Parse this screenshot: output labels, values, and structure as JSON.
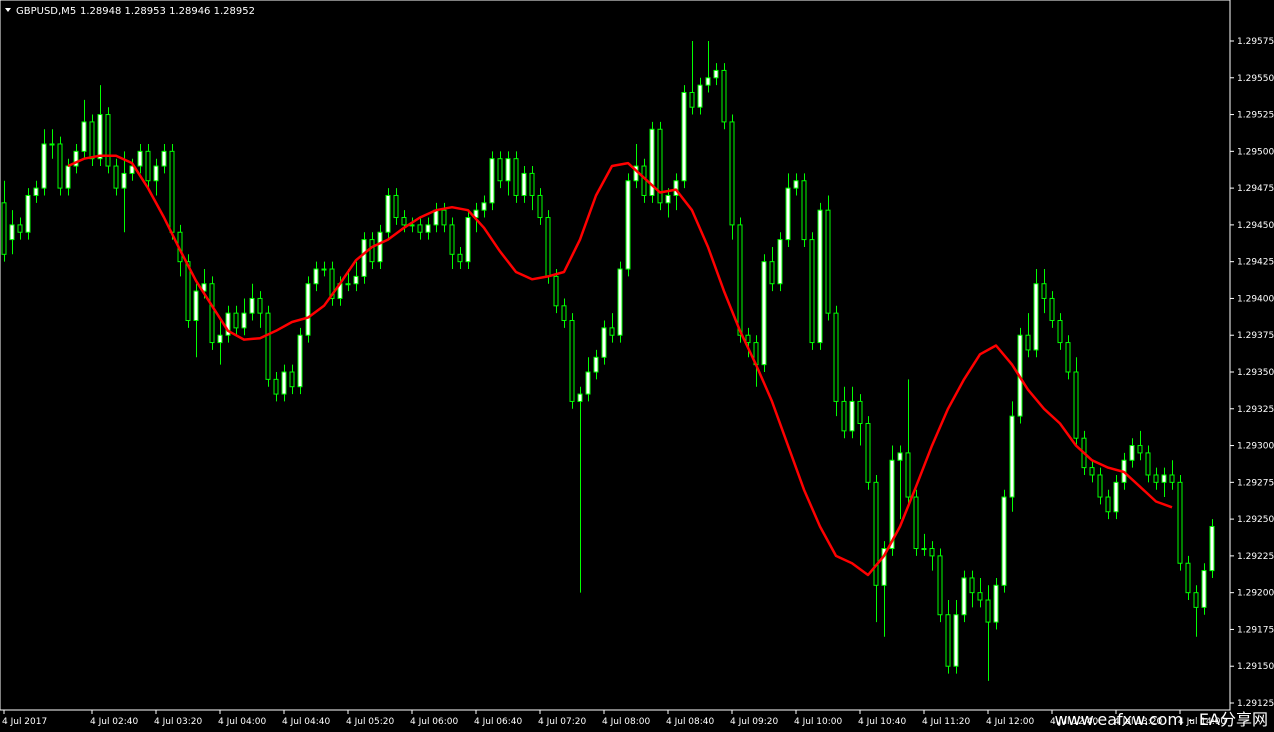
{
  "header": {
    "symbol": "GBPUSD,M5",
    "ohlc": "1.28948 1.28953 1.28946 1.28952",
    "menu_icon": "triangle-down-icon"
  },
  "watermark": "www.eafxw.com - EA分享网",
  "colors": {
    "background": "#000000",
    "frame": "#ffffff",
    "bull_fill": "#ffffff",
    "bear_fill": "#000000",
    "wick": "#00ff00",
    "ma_line": "#ff0000",
    "text": "#ffffff"
  },
  "chart_data": {
    "type": "candlestick",
    "title": "",
    "xlabel": "",
    "ylabel": "",
    "ylim": [
      1.29125,
      1.29585
    ],
    "y_ticks": [
      1.29575,
      1.2955,
      1.29525,
      1.295,
      1.29475,
      1.2945,
      1.29425,
      1.294,
      1.29375,
      1.2935,
      1.29325,
      1.293,
      1.29275,
      1.2925,
      1.29225,
      1.292,
      1.29175,
      1.2915,
      1.29125
    ],
    "y_tick_labels": [
      "1.29575",
      "1.29550",
      "1.29525",
      "1.29500",
      "1.29475",
      "1.29450",
      "1.29425",
      "1.29400",
      "1.29375",
      "1.29350",
      "1.29325",
      "1.29300",
      "1.29275",
      "1.29250",
      "1.29225",
      "1.29200",
      "1.29175",
      "1.29150",
      "1.29125"
    ],
    "x_ticks": [
      {
        "label": "4 Jul 2017",
        "bar": 0
      },
      {
        "label": "4 Jul 02:40",
        "bar": 11
      },
      {
        "label": "4 Jul 03:20",
        "bar": 19
      },
      {
        "label": "4 Jul 04:00",
        "bar": 27
      },
      {
        "label": "4 Jul 04:40",
        "bar": 35
      },
      {
        "label": "4 Jul 05:20",
        "bar": 43
      },
      {
        "label": "4 Jul 06:00",
        "bar": 51
      },
      {
        "label": "4 Jul 06:40",
        "bar": 59
      },
      {
        "label": "4 Jul 07:20",
        "bar": 67
      },
      {
        "label": "4 Jul 08:00",
        "bar": 75
      },
      {
        "label": "4 Jul 08:40",
        "bar": 83
      },
      {
        "label": "4 Jul 09:20",
        "bar": 91
      },
      {
        "label": "4 Jul 10:00",
        "bar": 99
      },
      {
        "label": "4 Jul 10:40",
        "bar": 107
      },
      {
        "label": "4 Jul 11:20",
        "bar": 115
      },
      {
        "label": "4 Jul 12:00",
        "bar": 123
      },
      {
        "label": "4 Jul 12:40",
        "bar": 131
      },
      {
        "label": "4 Jul 13:20",
        "bar": 139
      },
      {
        "label": "4 Jul 14:00",
        "bar": 147
      }
    ],
    "bar_count": 154,
    "candles": [
      [
        1.29465,
        1.2943,
        1.2948,
        1.29425
      ],
      [
        1.2944,
        1.2945,
        1.2946,
        1.2943
      ],
      [
        1.2945,
        1.29445,
        1.29455,
        1.2944
      ],
      [
        1.29445,
        1.2947,
        1.29475,
        1.2944
      ],
      [
        1.2947,
        1.29475,
        1.2948,
        1.29465
      ],
      [
        1.29475,
        1.29505,
        1.29515,
        1.2947
      ],
      [
        1.29505,
        1.29505,
        1.29515,
        1.29495
      ],
      [
        1.29505,
        1.29475,
        1.2951,
        1.2947
      ],
      [
        1.29475,
        1.2949,
        1.29495,
        1.2947
      ],
      [
        1.2949,
        1.295,
        1.29505,
        1.29485
      ],
      [
        1.295,
        1.2952,
        1.29535,
        1.29495
      ],
      [
        1.2952,
        1.29495,
        1.29525,
        1.2949
      ],
      [
        1.29495,
        1.29525,
        1.29545,
        1.2949
      ],
      [
        1.29525,
        1.2949,
        1.2953,
        1.29485
      ],
      [
        1.2949,
        1.29475,
        1.29495,
        1.2947
      ],
      [
        1.29475,
        1.29485,
        1.295,
        1.29445
      ],
      [
        1.29485,
        1.2949,
        1.29495,
        1.2948
      ],
      [
        1.2949,
        1.295,
        1.29505,
        1.29485
      ],
      [
        1.295,
        1.2948,
        1.29505,
        1.29475
      ],
      [
        1.2948,
        1.2949,
        1.29495,
        1.2947
      ],
      [
        1.2949,
        1.295,
        1.29505,
        1.29485
      ],
      [
        1.295,
        1.29445,
        1.29505,
        1.2944
      ],
      [
        1.29445,
        1.29425,
        1.2945,
        1.29415
      ],
      [
        1.29425,
        1.29385,
        1.2943,
        1.2938
      ],
      [
        1.29385,
        1.29405,
        1.2941,
        1.2936
      ],
      [
        1.29405,
        1.2941,
        1.2942,
        1.294
      ],
      [
        1.2941,
        1.2937,
        1.29415,
        1.29365
      ],
      [
        1.2937,
        1.29375,
        1.29385,
        1.29355
      ],
      [
        1.29375,
        1.2939,
        1.29395,
        1.2937
      ],
      [
        1.2939,
        1.2938,
        1.29395,
        1.29375
      ],
      [
        1.2938,
        1.2939,
        1.294,
        1.29375
      ],
      [
        1.2939,
        1.294,
        1.2941,
        1.29385
      ],
      [
        1.294,
        1.2939,
        1.29405,
        1.2938
      ],
      [
        1.2939,
        1.29345,
        1.29395,
        1.2934
      ],
      [
        1.29345,
        1.29335,
        1.2935,
        1.2933
      ],
      [
        1.29335,
        1.2935,
        1.29355,
        1.2933
      ],
      [
        1.2935,
        1.2934,
        1.29355,
        1.29335
      ],
      [
        1.2934,
        1.29375,
        1.2938,
        1.29335
      ],
      [
        1.29375,
        1.2941,
        1.29415,
        1.2937
      ],
      [
        1.2941,
        1.2942,
        1.29425,
        1.29405
      ],
      [
        1.2942,
        1.2942,
        1.29425,
        1.29415
      ],
      [
        1.2942,
        1.294,
        1.29425,
        1.29395
      ],
      [
        1.294,
        1.2941,
        1.29415,
        1.29395
      ],
      [
        1.2941,
        1.2941,
        1.2942,
        1.29405
      ],
      [
        1.2941,
        1.29415,
        1.29425,
        1.29405
      ],
      [
        1.29415,
        1.2944,
        1.29445,
        1.2941
      ],
      [
        1.2944,
        1.29425,
        1.29445,
        1.2942
      ],
      [
        1.29425,
        1.29445,
        1.2945,
        1.2942
      ],
      [
        1.29445,
        1.2947,
        1.29475,
        1.2944
      ],
      [
        1.2947,
        1.29455,
        1.29475,
        1.2945
      ],
      [
        1.29455,
        1.2945,
        1.2946,
        1.29445
      ],
      [
        1.2945,
        1.2945,
        1.29455,
        1.29445
      ],
      [
        1.2945,
        1.29445,
        1.29455,
        1.2944
      ],
      [
        1.29445,
        1.2945,
        1.29455,
        1.2944
      ],
      [
        1.2945,
        1.2946,
        1.29465,
        1.29445
      ],
      [
        1.2946,
        1.2945,
        1.29465,
        1.29445
      ],
      [
        1.2945,
        1.2943,
        1.29455,
        1.2942
      ],
      [
        1.2943,
        1.29425,
        1.29435,
        1.2942
      ],
      [
        1.29425,
        1.29455,
        1.2946,
        1.2942
      ],
      [
        1.29455,
        1.2946,
        1.29465,
        1.29445
      ],
      [
        1.2946,
        1.29465,
        1.2947,
        1.29455
      ],
      [
        1.29465,
        1.29495,
        1.295,
        1.2946
      ],
      [
        1.29495,
        1.2948,
        1.295,
        1.29475
      ],
      [
        1.2948,
        1.29495,
        1.295,
        1.2947
      ],
      [
        1.29495,
        1.2947,
        1.295,
        1.29465
      ],
      [
        1.2947,
        1.29485,
        1.2949,
        1.29465
      ],
      [
        1.29485,
        1.2947,
        1.2949,
        1.2946
      ],
      [
        1.2947,
        1.29455,
        1.29475,
        1.2945
      ],
      [
        1.29455,
        1.29415,
        1.2946,
        1.2941
      ],
      [
        1.29415,
        1.29395,
        1.2942,
        1.2939
      ],
      [
        1.29395,
        1.29385,
        1.294,
        1.2938
      ],
      [
        1.29385,
        1.2933,
        1.2939,
        1.29325
      ],
      [
        1.2933,
        1.29335,
        1.2934,
        1.292
      ],
      [
        1.29335,
        1.2935,
        1.2936,
        1.2933
      ],
      [
        1.2935,
        1.2936,
        1.29365,
        1.29345
      ],
      [
        1.2936,
        1.2938,
        1.29385,
        1.29355
      ],
      [
        1.2938,
        1.29375,
        1.2939,
        1.2937
      ],
      [
        1.29375,
        1.2942,
        1.29425,
        1.2937
      ],
      [
        1.2942,
        1.2948,
        1.29485,
        1.29415
      ],
      [
        1.2948,
        1.2949,
        1.29505,
        1.29475
      ],
      [
        1.2949,
        1.2947,
        1.29495,
        1.29465
      ],
      [
        1.2947,
        1.29515,
        1.2952,
        1.29465
      ],
      [
        1.29515,
        1.29465,
        1.2952,
        1.2946
      ],
      [
        1.29465,
        1.2947,
        1.29475,
        1.29455
      ],
      [
        1.2947,
        1.2948,
        1.29485,
        1.2946
      ],
      [
        1.2948,
        1.2954,
        1.29545,
        1.29475
      ],
      [
        1.2954,
        1.2953,
        1.29575,
        1.29525
      ],
      [
        1.2953,
        1.29545,
        1.2955,
        1.29525
      ],
      [
        1.29545,
        1.2955,
        1.29575,
        1.2954
      ],
      [
        1.2955,
        1.29555,
        1.2956,
        1.29545
      ],
      [
        1.29555,
        1.2952,
        1.2956,
        1.29515
      ],
      [
        1.2952,
        1.2945,
        1.29525,
        1.2944
      ],
      [
        1.2945,
        1.29375,
        1.29455,
        1.2937
      ],
      [
        1.29375,
        1.2937,
        1.2938,
        1.2936
      ],
      [
        1.2937,
        1.29355,
        1.29375,
        1.2934
      ],
      [
        1.29355,
        1.29425,
        1.2943,
        1.2935
      ],
      [
        1.29425,
        1.2941,
        1.29435,
        1.29405
      ],
      [
        1.2941,
        1.2944,
        1.29445,
        1.29405
      ],
      [
        1.2944,
        1.29475,
        1.29485,
        1.29435
      ],
      [
        1.29475,
        1.2948,
        1.29485,
        1.2947
      ],
      [
        1.2948,
        1.2944,
        1.29485,
        1.29435
      ],
      [
        1.2944,
        1.2937,
        1.29445,
        1.29365
      ],
      [
        1.2937,
        1.2946,
        1.29465,
        1.29365
      ],
      [
        1.2946,
        1.2939,
        1.2947,
        1.29385
      ],
      [
        1.2939,
        1.2933,
        1.29395,
        1.2932
      ],
      [
        1.2933,
        1.2931,
        1.2934,
        1.29305
      ],
      [
        1.2931,
        1.2933,
        1.2934,
        1.29305
      ],
      [
        1.2933,
        1.29315,
        1.29335,
        1.293
      ],
      [
        1.29315,
        1.29275,
        1.2932,
        1.2927
      ],
      [
        1.29275,
        1.29205,
        1.2928,
        1.2918
      ],
      [
        1.29205,
        1.2923,
        1.29235,
        1.2917
      ],
      [
        1.2923,
        1.2929,
        1.293,
        1.29225
      ],
      [
        1.2929,
        1.29295,
        1.293,
        1.2925
      ],
      [
        1.29295,
        1.29265,
        1.29345,
        1.2926
      ],
      [
        1.29265,
        1.2923,
        1.2927,
        1.29225
      ],
      [
        1.2923,
        1.2923,
        1.2924,
        1.29225
      ],
      [
        1.2923,
        1.29225,
        1.29235,
        1.29215
      ],
      [
        1.29225,
        1.29185,
        1.2923,
        1.2918
      ],
      [
        1.29185,
        1.2915,
        1.29195,
        1.29145
      ],
      [
        1.2915,
        1.29185,
        1.29195,
        1.29145
      ],
      [
        1.29185,
        1.2921,
        1.29215,
        1.2918
      ],
      [
        1.2921,
        1.292,
        1.29215,
        1.2919
      ],
      [
        1.292,
        1.29195,
        1.2921,
        1.2919
      ],
      [
        1.29195,
        1.2918,
        1.29205,
        1.2914
      ],
      [
        1.2918,
        1.29205,
        1.2921,
        1.29175
      ],
      [
        1.29205,
        1.29265,
        1.2927,
        1.292
      ],
      [
        1.29265,
        1.2932,
        1.2933,
        1.29255
      ],
      [
        1.2932,
        1.29375,
        1.2938,
        1.29315
      ],
      [
        1.29375,
        1.29365,
        1.2939,
        1.2936
      ],
      [
        1.29365,
        1.2941,
        1.2942,
        1.2936
      ],
      [
        1.2941,
        1.294,
        1.2942,
        1.2939
      ],
      [
        1.294,
        1.29385,
        1.29405,
        1.2938
      ],
      [
        1.29385,
        1.2937,
        1.2939,
        1.29365
      ],
      [
        1.2937,
        1.2935,
        1.29375,
        1.29345
      ],
      [
        1.2935,
        1.29305,
        1.2936,
        1.293
      ],
      [
        1.29305,
        1.29285,
        1.2931,
        1.2928
      ],
      [
        1.29285,
        1.2928,
        1.2929,
        1.29275
      ],
      [
        1.2928,
        1.29265,
        1.29285,
        1.2926
      ],
      [
        1.29265,
        1.29255,
        1.2927,
        1.2925
      ],
      [
        1.29255,
        1.29275,
        1.2928,
        1.2925
      ],
      [
        1.29275,
        1.2929,
        1.29295,
        1.2927
      ],
      [
        1.2929,
        1.293,
        1.29305,
        1.29285
      ],
      [
        1.293,
        1.29295,
        1.2931,
        1.2929
      ],
      [
        1.29295,
        1.2928,
        1.293,
        1.29275
      ],
      [
        1.2928,
        1.29275,
        1.29285,
        1.2927
      ],
      [
        1.29275,
        1.2928,
        1.29285,
        1.29265
      ],
      [
        1.2928,
        1.29275,
        1.2929,
        1.2927
      ],
      [
        1.29275,
        1.2922,
        1.2928,
        1.29215
      ],
      [
        1.2922,
        1.292,
        1.29225,
        1.29195
      ],
      [
        1.292,
        1.2919,
        1.29205,
        1.2917
      ],
      [
        1.2919,
        1.29215,
        1.2922,
        1.29185
      ],
      [
        1.29215,
        1.29245,
        1.2925,
        1.2921
      ]
    ],
    "ma": [
      [
        8,
        1.2949
      ],
      [
        10,
        1.29495
      ],
      [
        12,
        1.29497
      ],
      [
        14,
        1.29497
      ],
      [
        16,
        1.29492
      ],
      [
        18,
        1.29475
      ],
      [
        20,
        1.29455
      ],
      [
        22,
        1.29433
      ],
      [
        24,
        1.29412
      ],
      [
        26,
        1.29395
      ],
      [
        28,
        1.29378
      ],
      [
        30,
        1.29372
      ],
      [
        32,
        1.29373
      ],
      [
        34,
        1.29378
      ],
      [
        36,
        1.29384
      ],
      [
        38,
        1.29387
      ],
      [
        40,
        1.29395
      ],
      [
        42,
        1.2941
      ],
      [
        44,
        1.29426
      ],
      [
        46,
        1.29435
      ],
      [
        48,
        1.2944
      ],
      [
        50,
        1.29448
      ],
      [
        52,
        1.29455
      ],
      [
        54,
        1.2946
      ],
      [
        56,
        1.29462
      ],
      [
        58,
        1.2946
      ],
      [
        60,
        1.29448
      ],
      [
        62,
        1.29432
      ],
      [
        64,
        1.29418
      ],
      [
        66,
        1.29413
      ],
      [
        68,
        1.29415
      ],
      [
        70,
        1.29418
      ],
      [
        72,
        1.2944
      ],
      [
        74,
        1.2947
      ],
      [
        76,
        1.2949
      ],
      [
        78,
        1.29492
      ],
      [
        80,
        1.29482
      ],
      [
        82,
        1.29472
      ],
      [
        84,
        1.29474
      ],
      [
        86,
        1.2946
      ],
      [
        88,
        1.29435
      ],
      [
        90,
        1.29405
      ],
      [
        92,
        1.29378
      ],
      [
        94,
        1.29355
      ],
      [
        96,
        1.2933
      ],
      [
        98,
        1.293
      ],
      [
        100,
        1.2927
      ],
      [
        102,
        1.29245
      ],
      [
        104,
        1.29225
      ],
      [
        106,
        1.2922
      ],
      [
        108,
        1.29212
      ],
      [
        110,
        1.29225
      ],
      [
        112,
        1.29245
      ],
      [
        114,
        1.29272
      ],
      [
        116,
        1.293
      ],
      [
        118,
        1.29325
      ],
      [
        120,
        1.29345
      ],
      [
        122,
        1.29362
      ],
      [
        124,
        1.29368
      ],
      [
        126,
        1.29355
      ],
      [
        128,
        1.29338
      ],
      [
        130,
        1.29325
      ],
      [
        132,
        1.29315
      ],
      [
        134,
        1.293
      ],
      [
        136,
        1.2929
      ],
      [
        138,
        1.29285
      ],
      [
        140,
        1.29282
      ],
      [
        142,
        1.29272
      ],
      [
        144,
        1.29262
      ],
      [
        146,
        1.29258
      ]
    ]
  }
}
